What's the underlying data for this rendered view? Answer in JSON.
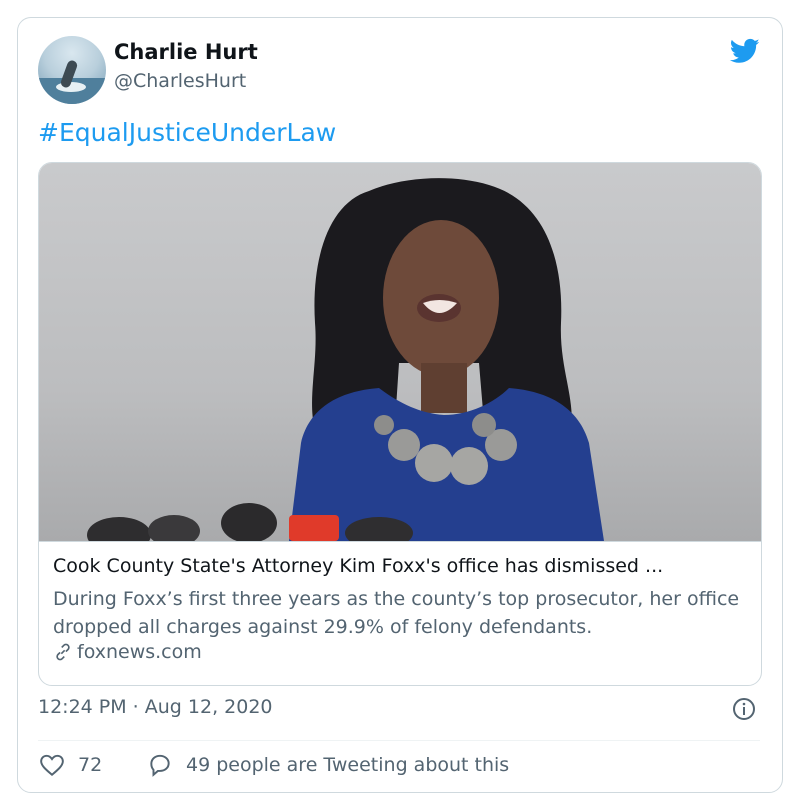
{
  "tweet": {
    "author_name": "Charlie Hurt",
    "author_handle": "@CharlesHurt",
    "text": "#EqualJusticeUnderLaw",
    "timestamp": "12:24 PM · Aug 12, 2020"
  },
  "link_card": {
    "title": "Cook County State's Attorney Kim Foxx's office has dismissed ...",
    "description": "During Foxx’s first three years as the county’s top prosecutor, her office dropped all charges against 29.9% of felony defendants.",
    "domain": "foxnews.com"
  },
  "stats": {
    "likes": "72",
    "conversation": "49 people are Tweeting about this"
  },
  "colors": {
    "accent": "#1d9bf0",
    "secondary_text": "#536471",
    "border": "#cfd9de"
  },
  "icons": [
    "twitter-bird-icon",
    "link-icon",
    "info-icon",
    "heart-icon",
    "reply-bubble-icon"
  ]
}
